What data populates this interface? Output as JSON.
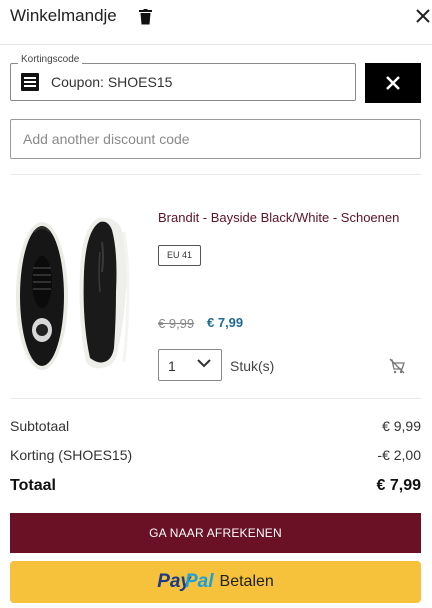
{
  "header": {
    "title": "Winkelmandje"
  },
  "coupon": {
    "legend": "Kortingscode",
    "applied": "Coupon: SHOES15"
  },
  "discount": {
    "placeholder": "Add another discount code"
  },
  "product": {
    "name": "Brandit - Bayside Black/White - Schoenen",
    "size": "EU 41",
    "old_price": "€ 9,99",
    "price": "€ 7,99",
    "quantity": "1",
    "unit": "Stuk(s)"
  },
  "summary": {
    "subtotal_label": "Subtotaal",
    "subtotal_value": "€ 9,99",
    "discount_label": "Korting (SHOES15)",
    "discount_value": "-€ 2,00",
    "total_label": "Totaal",
    "total_value": "€ 7,99"
  },
  "buttons": {
    "checkout": "GA NAAR AFREKENEN",
    "paypal_pay": "Pay",
    "paypal_pal": "Pal",
    "paypal_betalen": "Betalen"
  },
  "colors": {
    "checkout_bg": "#6a1125",
    "product_name": "#5c1326",
    "price_new": "#1f6a95",
    "paypal_bg": "#f7c23b"
  },
  "icons": {
    "trash": "trash-icon",
    "close": "close-icon",
    "coupon": "coupon-menu-icon",
    "remove_coupon": "close-icon",
    "chevron": "chevron-down-icon",
    "cart_remove": "cart-remove-icon"
  }
}
